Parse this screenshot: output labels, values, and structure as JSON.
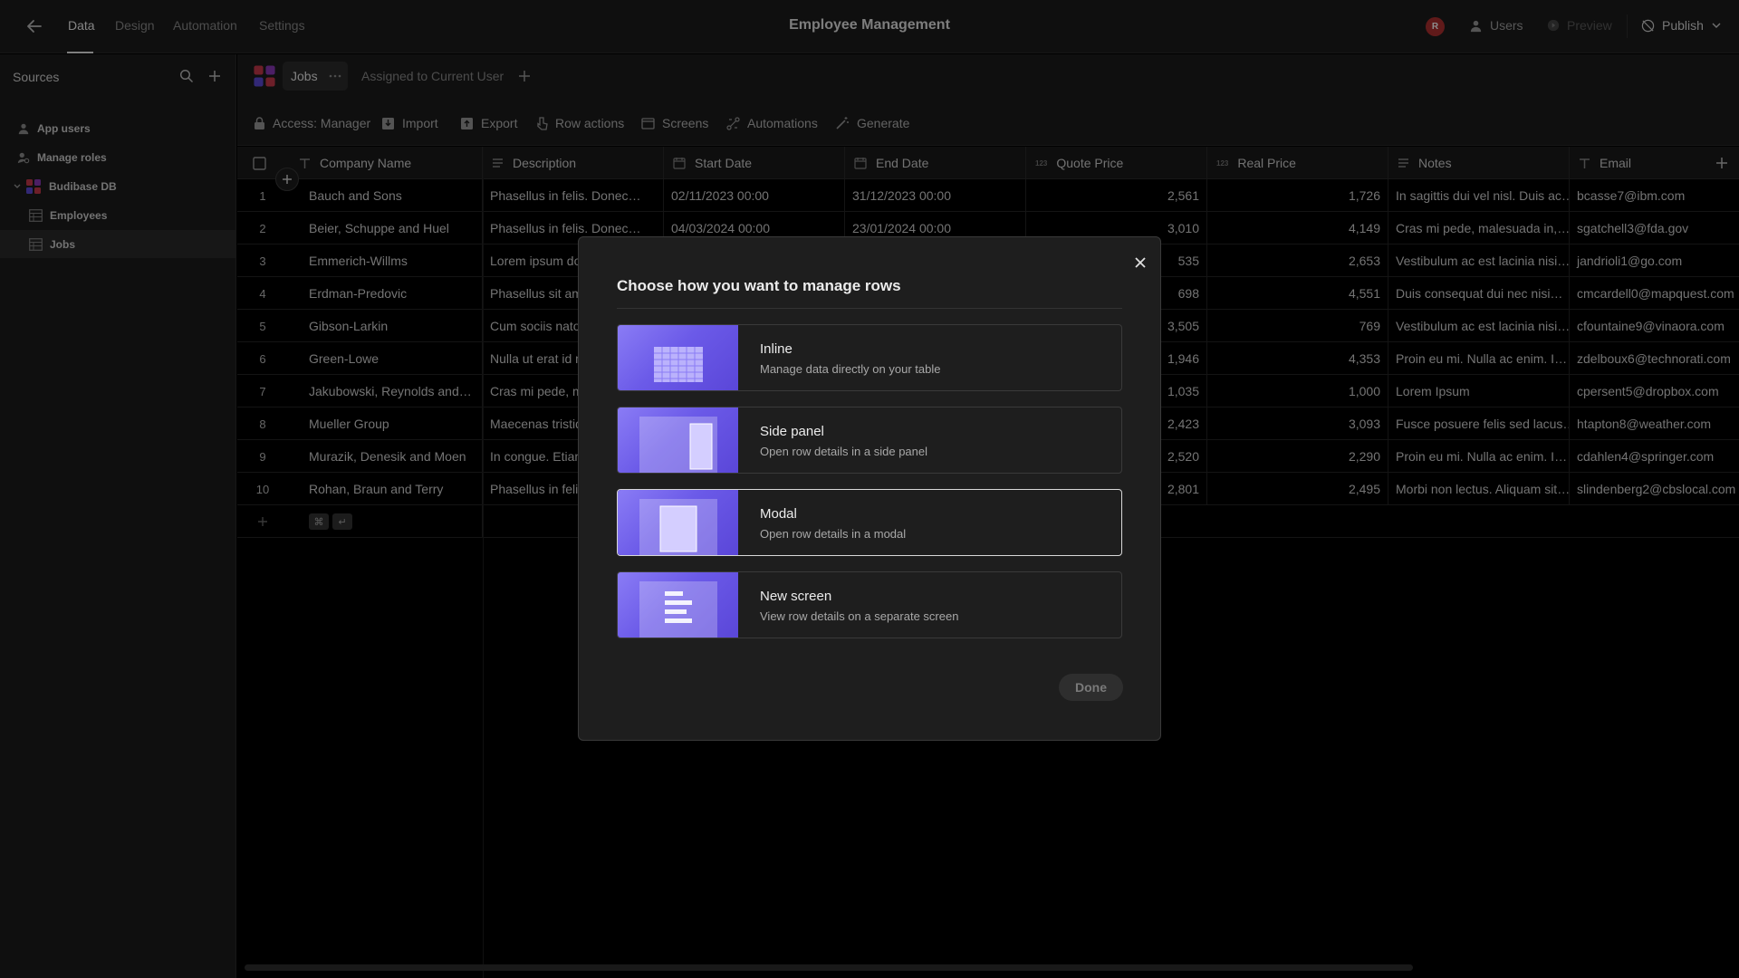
{
  "topbar": {
    "tabs": [
      "Data",
      "Design",
      "Automation",
      "Settings"
    ],
    "title": "Employee Management",
    "avatar_initial": "R",
    "users_label": "Users",
    "preview_label": "Preview",
    "publish_label": "Publish"
  },
  "sidebar": {
    "title": "Sources",
    "items": [
      {
        "label": "App users",
        "icon": "user-icon"
      },
      {
        "label": "Manage roles",
        "icon": "roles-icon"
      },
      {
        "label": "Budibase DB",
        "icon": "budibase-db-icon"
      },
      {
        "label": "Employees",
        "icon": "table-icon"
      },
      {
        "label": "Jobs",
        "icon": "table-icon",
        "selected": true
      }
    ]
  },
  "tabsbar": {
    "table_tab": "Jobs",
    "view_tab": "Assigned to Current User"
  },
  "toolbar": {
    "items": [
      "Access: Manager",
      "Import",
      "Export",
      "Row actions",
      "Screens",
      "Automations",
      "Generate"
    ]
  },
  "grid": {
    "columns": [
      "Company Name",
      "Description",
      "Start Date",
      "End Date",
      "Quote Price",
      "Real Price",
      "Notes",
      "Email"
    ],
    "rows": [
      {
        "n": "1",
        "company": "Bauch and Sons",
        "desc": "Phasellus in felis. Donec…",
        "start": "02/11/2023 00:00",
        "end": "31/12/2023 00:00",
        "quote": "2,561",
        "real": "1,726",
        "notes": "In sagittis dui vel nisl. Duis ac…",
        "email": "bcasse7@ibm.com"
      },
      {
        "n": "2",
        "company": "Beier, Schuppe and Huel",
        "desc": "Phasellus in felis. Donec…",
        "start": "04/03/2024 00:00",
        "end": "23/01/2024 00:00",
        "quote": "3,010",
        "real": "4,149",
        "notes": "Cras mi pede, malesuada in,…",
        "email": "sgatchell3@fda.gov"
      },
      {
        "n": "3",
        "company": "Emmerich-Willms",
        "desc": "Lorem ipsum do",
        "start": "",
        "end": "",
        "quote": "535",
        "real": "2,653",
        "notes": "Vestibulum ac est lacinia nisi…",
        "email": "jandrioli1@go.com"
      },
      {
        "n": "4",
        "company": "Erdman-Predovic",
        "desc": "Phasellus sit ame",
        "start": "",
        "end": "",
        "quote": "698",
        "real": "4,551",
        "notes": "Duis consequat dui nec nisi…",
        "email": "cmcardell0@mapquest.com"
      },
      {
        "n": "5",
        "company": "Gibson-Larkin",
        "desc": "Cum sociis natoq",
        "start": "",
        "end": "",
        "quote": "3,505",
        "real": "769",
        "notes": "Vestibulum ac est lacinia nisi…",
        "email": "cfountaine9@vinaora.com"
      },
      {
        "n": "6",
        "company": "Green-Lowe",
        "desc": "Nulla ut erat id m",
        "start": "",
        "end": "",
        "quote": "1,946",
        "real": "4,353",
        "notes": "Proin eu mi. Nulla ac enim. I…",
        "email": "zdelboux6@technorati.com"
      },
      {
        "n": "7",
        "company": "Jakubowski, Reynolds and…",
        "desc": "Cras mi pede, ma",
        "start": "",
        "end": "",
        "quote": "1,035",
        "real": "1,000",
        "notes": "Lorem Ipsum",
        "email": "cpersent5@dropbox.com"
      },
      {
        "n": "8",
        "company": "Mueller Group",
        "desc": "Maecenas tristiq",
        "start": "",
        "end": "",
        "quote": "2,423",
        "real": "3,093",
        "notes": "Fusce posuere felis sed lacus…",
        "email": "htapton8@weather.com"
      },
      {
        "n": "9",
        "company": "Murazik, Denesik and Moen",
        "desc": "In congue. Etiam",
        "start": "",
        "end": "",
        "quote": "2,520",
        "real": "2,290",
        "notes": "Proin eu mi. Nulla ac enim. I…",
        "email": "cdahlen4@springer.com"
      },
      {
        "n": "10",
        "company": "Rohan, Braun and Terry",
        "desc": "Phasellus in felis",
        "start": "",
        "end": "",
        "quote": "2,801",
        "real": "2,495",
        "notes": "Morbi non lectus. Aliquam sit…",
        "email": "slindenberg2@cbslocal.com"
      }
    ],
    "shortcut_keys": [
      "⌘",
      "↵"
    ]
  },
  "modal": {
    "title": "Choose how you want to manage rows",
    "options": [
      {
        "title": "Inline",
        "desc": "Manage data directly on your table"
      },
      {
        "title": "Side panel",
        "desc": "Open row details in a side panel"
      },
      {
        "title": "Modal",
        "desc": "Open row details in a modal"
      },
      {
        "title": "New screen",
        "desc": "View row details on a separate screen"
      }
    ],
    "selected_option": "Modal",
    "done_label": "Done"
  },
  "colors": {
    "accent_purple": "#6b5ae8",
    "background": "#000000",
    "panel": "#1d1d1d"
  }
}
